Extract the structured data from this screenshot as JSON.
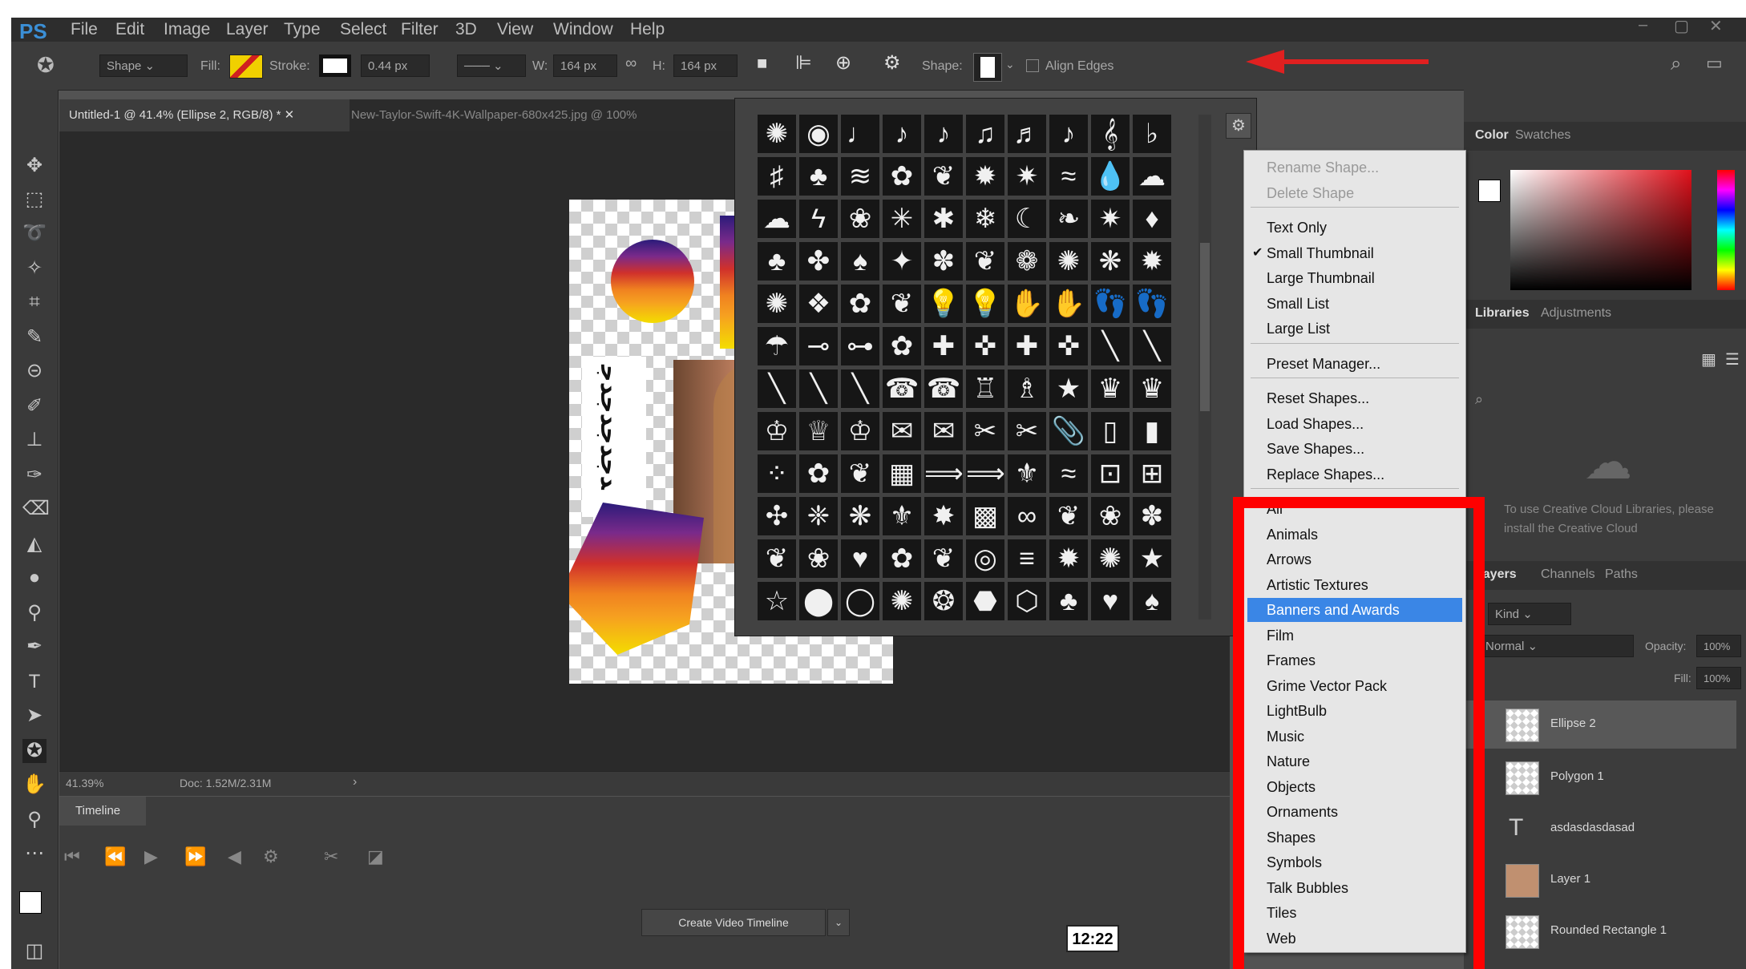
{
  "app": {
    "logo": "PS"
  },
  "menubar": {
    "items": [
      "File",
      "Edit",
      "Image",
      "Layer",
      "Type",
      "Select",
      "Filter",
      "3D",
      "View",
      "Window",
      "Help"
    ]
  },
  "options": {
    "mode": "Shape",
    "fill_label": "Fill:",
    "stroke_label": "Stroke:",
    "stroke_width": "0.44 px",
    "w_label": "W:",
    "w_value": "164 px",
    "h_label": "H:",
    "h_value": "164 px",
    "shape_label": "Shape:",
    "align_edges": "Align Edges"
  },
  "document": {
    "tabs": [
      "Untitled-1 @ 41.4% (Ellipse 2, RGB/8) *",
      "New-Taylor-Swift-4K-Wallpaper-680x425.jpg @ 100%"
    ],
    "artboard_text": "ﺪﺟﺪﺟﺪﺟﺪﺟ",
    "zoom": "41.39%",
    "doc_size": "Doc: 1.52M/2.31M"
  },
  "timeline": {
    "tab": "Timeline",
    "create_button": "Create Video Timeline",
    "time": "12:22"
  },
  "shape_picker": {
    "glyphs": [
      "✺",
      "◉",
      "♩",
      "♪",
      "♪",
      "♫",
      "♬",
      "♪",
      "𝄞",
      "♭",
      "♯",
      "♣",
      "≋",
      "✿",
      "❦",
      "✹",
      "✷",
      "≈",
      "💧",
      "☁",
      "☁",
      "ϟ",
      "❀",
      "✳",
      "✱",
      "❄",
      "☾",
      "❧",
      "✷",
      "♦",
      "♣",
      "✤",
      "♠",
      "✦",
      "✽",
      "❦",
      "❁",
      "✺",
      "❋",
      "✹",
      "✺",
      "❖",
      "✿",
      "❦",
      "💡",
      "💡",
      "✋",
      "✋",
      "👣",
      "👣",
      "☂",
      "⊸",
      "⊶",
      "✿",
      "✚",
      "✜",
      "✚",
      "✜",
      "╲",
      "╲",
      "╲",
      "╲",
      "╲",
      "☎",
      "☎",
      "♖",
      "♗",
      "★",
      "♛",
      "♛",
      "♔",
      "♕",
      "♔",
      "✉",
      "✉",
      "✂",
      "✂",
      "📎",
      "▯",
      "▮",
      "⁘",
      "✿",
      "❦",
      "▦",
      "⟹",
      "⟹",
      "⚜",
      "≈",
      "⊡",
      "⊞",
      "✣",
      "❈",
      "❋",
      "⚜",
      "✸",
      "▩",
      "∞",
      "❦",
      "❀",
      "✽",
      "❦",
      "❀",
      "♥",
      "✿",
      "❦",
      "◎",
      "≡",
      "✹",
      "✺",
      "★",
      "☆",
      "⬤",
      "◯",
      "✺",
      "❂",
      "⬣",
      "⬡",
      "♣",
      "♥",
      "♠"
    ]
  },
  "context_menu": {
    "items": [
      {
        "label": "Rename Shape...",
        "disabled": true
      },
      {
        "label": "Delete Shape",
        "disabled": true
      },
      {
        "label": "Text Only"
      },
      {
        "label": "Small Thumbnail",
        "checked": true
      },
      {
        "label": "Large Thumbnail"
      },
      {
        "label": "Small List"
      },
      {
        "label": "Large List"
      },
      {
        "label": "Preset Manager..."
      },
      {
        "label": "Reset Shapes..."
      },
      {
        "label": "Load Shapes..."
      },
      {
        "label": "Save Shapes..."
      },
      {
        "label": "Replace Shapes..."
      },
      {
        "label": "All"
      },
      {
        "label": "Animals"
      },
      {
        "label": "Arrows"
      },
      {
        "label": "Artistic Textures"
      },
      {
        "label": "Banners and Awards",
        "highlighted": true
      },
      {
        "label": "Film"
      },
      {
        "label": "Frames"
      },
      {
        "label": "Grime Vector Pack"
      },
      {
        "label": "LightBulb"
      },
      {
        "label": "Music"
      },
      {
        "label": "Nature"
      },
      {
        "label": "Objects"
      },
      {
        "label": "Ornaments"
      },
      {
        "label": "Shapes"
      },
      {
        "label": "Symbols"
      },
      {
        "label": "Talk Bubbles"
      },
      {
        "label": "Tiles"
      },
      {
        "label": "Web"
      }
    ]
  },
  "panels": {
    "color_tab": "Color",
    "swatches_tab": "Swatches",
    "libraries_tab": "Libraries",
    "adjustments_tab": "Adjustments",
    "libraries_msg": "To use Creative Cloud Libraries, please install the Creative Cloud",
    "layers_tab": "Layers",
    "channels_tab": "Channels",
    "paths_tab": "Paths",
    "kind": "Kind",
    "blend": "Normal",
    "opacity_label": "Opacity:",
    "opacity": "100%",
    "fill_label": "Fill:",
    "fill": "100%",
    "layers": [
      "Ellipse 2",
      "Polygon 1",
      "asdasdasdasad",
      "Layer 1",
      "Rounded Rectangle 1"
    ]
  },
  "colors": {
    "accent": "#3a86e6",
    "highlight_box": "#ff0000",
    "arrow": "#e02020"
  }
}
